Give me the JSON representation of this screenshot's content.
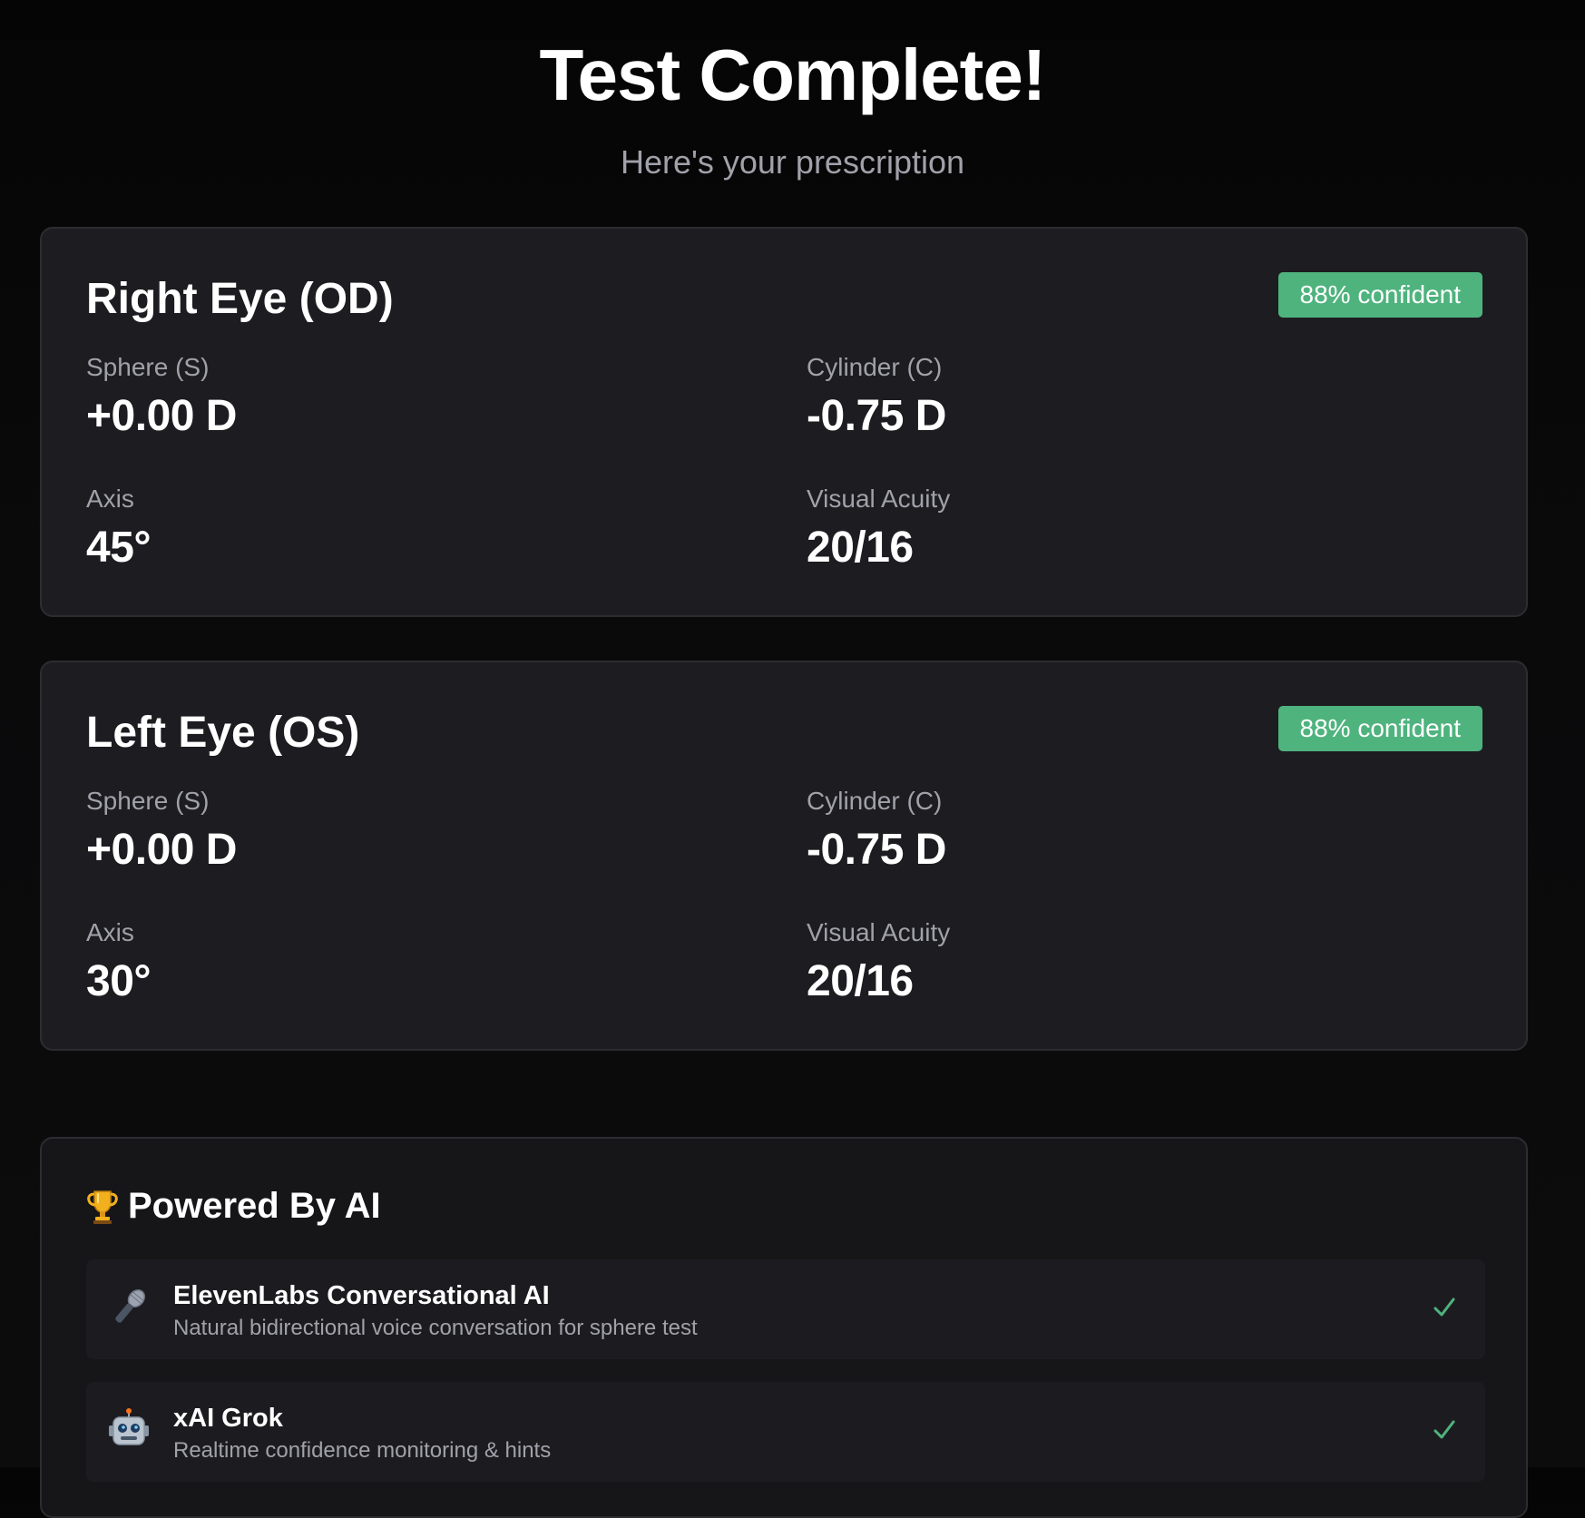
{
  "header": {
    "title": "Test Complete!",
    "subtitle": "Here's your prescription"
  },
  "right_eye": {
    "title": "Right Eye (OD)",
    "confidence": "88% confident",
    "sphere_label": "Sphere (S)",
    "sphere_value": "+0.00 D",
    "cylinder_label": "Cylinder (C)",
    "cylinder_value": "-0.75 D",
    "axis_label": "Axis",
    "axis_value": "45°",
    "acuity_label": "Visual Acuity",
    "acuity_value": "20/16"
  },
  "left_eye": {
    "title": "Left Eye (OS)",
    "confidence": "88% confident",
    "sphere_label": "Sphere (S)",
    "sphere_value": "+0.00 D",
    "cylinder_label": "Cylinder (C)",
    "cylinder_value": "-0.75 D",
    "axis_label": "Axis",
    "axis_value": "30°",
    "acuity_label": "Visual Acuity",
    "acuity_value": "20/16"
  },
  "powered_by": {
    "title": "Powered By AI",
    "icon": "trophy-icon",
    "items": [
      {
        "name": "ElevenLabs Conversational AI",
        "description": "Natural bidirectional voice conversation for sphere test",
        "icon": "microphone-icon",
        "status_icon": "check-icon"
      },
      {
        "name": "xAI Grok",
        "description": "Realtime confidence monitoring & hints",
        "icon": "robot-icon",
        "status_icon": "check-icon"
      }
    ]
  },
  "colors": {
    "background": "#0a0a0b",
    "card": "#1c1c21",
    "badge": "#4fb37e",
    "muted_text": "#a1a1aa",
    "check": "#4fb37e"
  }
}
